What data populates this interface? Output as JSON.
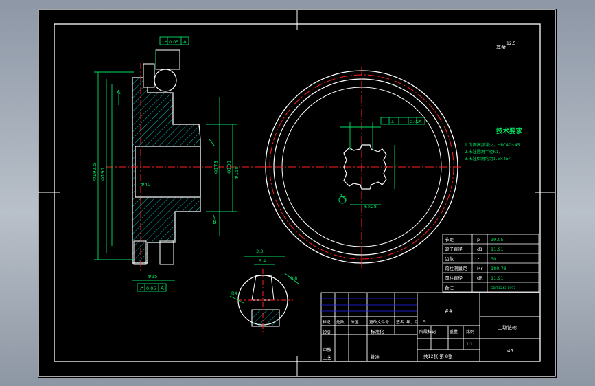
{
  "drawing": {
    "roughness_note": "其余",
    "roughness_value": "12.5",
    "tech_req": {
      "title": "技术要求",
      "items": [
        "1.齿面高频淬火，HRC40~45.",
        "2.未注圆角半径R1。",
        "3.未注倒角均为1.5×45°."
      ]
    },
    "section_labels": [
      "A",
      "B"
    ],
    "dims_left": [
      "Φ192.5",
      "Φ190",
      "Φ178",
      "Φ130",
      "Φ150",
      "Φ25",
      "Φ40"
    ],
    "tolerance_frames": [
      {
        "sym": "↗",
        "value": "0.05",
        "ref": "A"
      },
      {
        "sym": "↗",
        "value": "0.05",
        "ref": "A"
      },
      {
        "sym": "⊥",
        "value": "0.02",
        "ref": "A"
      }
    ],
    "spline_note": "6×28",
    "detail_dims": [
      "3.3",
      "5.4",
      "0.8",
      "R4"
    ],
    "params": [
      {
        "name": "节距",
        "sym": "p",
        "value": "19.05"
      },
      {
        "name": "滚子直径",
        "sym": "d1",
        "value": "11.91"
      },
      {
        "name": "齿数",
        "sym": "z",
        "value": "30"
      },
      {
        "name": "跨柱测量距",
        "sym": "Mr",
        "value": "180.78"
      },
      {
        "name": "圆柱直径",
        "sym": "dR",
        "value": "11.91"
      },
      {
        "name": "备注",
        "sym": "",
        "value": "GB/T1243-1997"
      }
    ],
    "title_block": {
      "header": [
        "标记",
        "处数",
        "分区",
        "更改文件号",
        "签名",
        "年、月、日"
      ],
      "rows_left": [
        "设计",
        "审核",
        "工艺"
      ],
      "std": "标准化",
      "approve": "批准",
      "stage": [
        "阶段标记",
        "重量",
        "比例"
      ],
      "scale": "1:1",
      "sheets": "共12张  第  8张",
      "part_name": "主动链轮",
      "material": "45",
      "company": "##"
    }
  }
}
